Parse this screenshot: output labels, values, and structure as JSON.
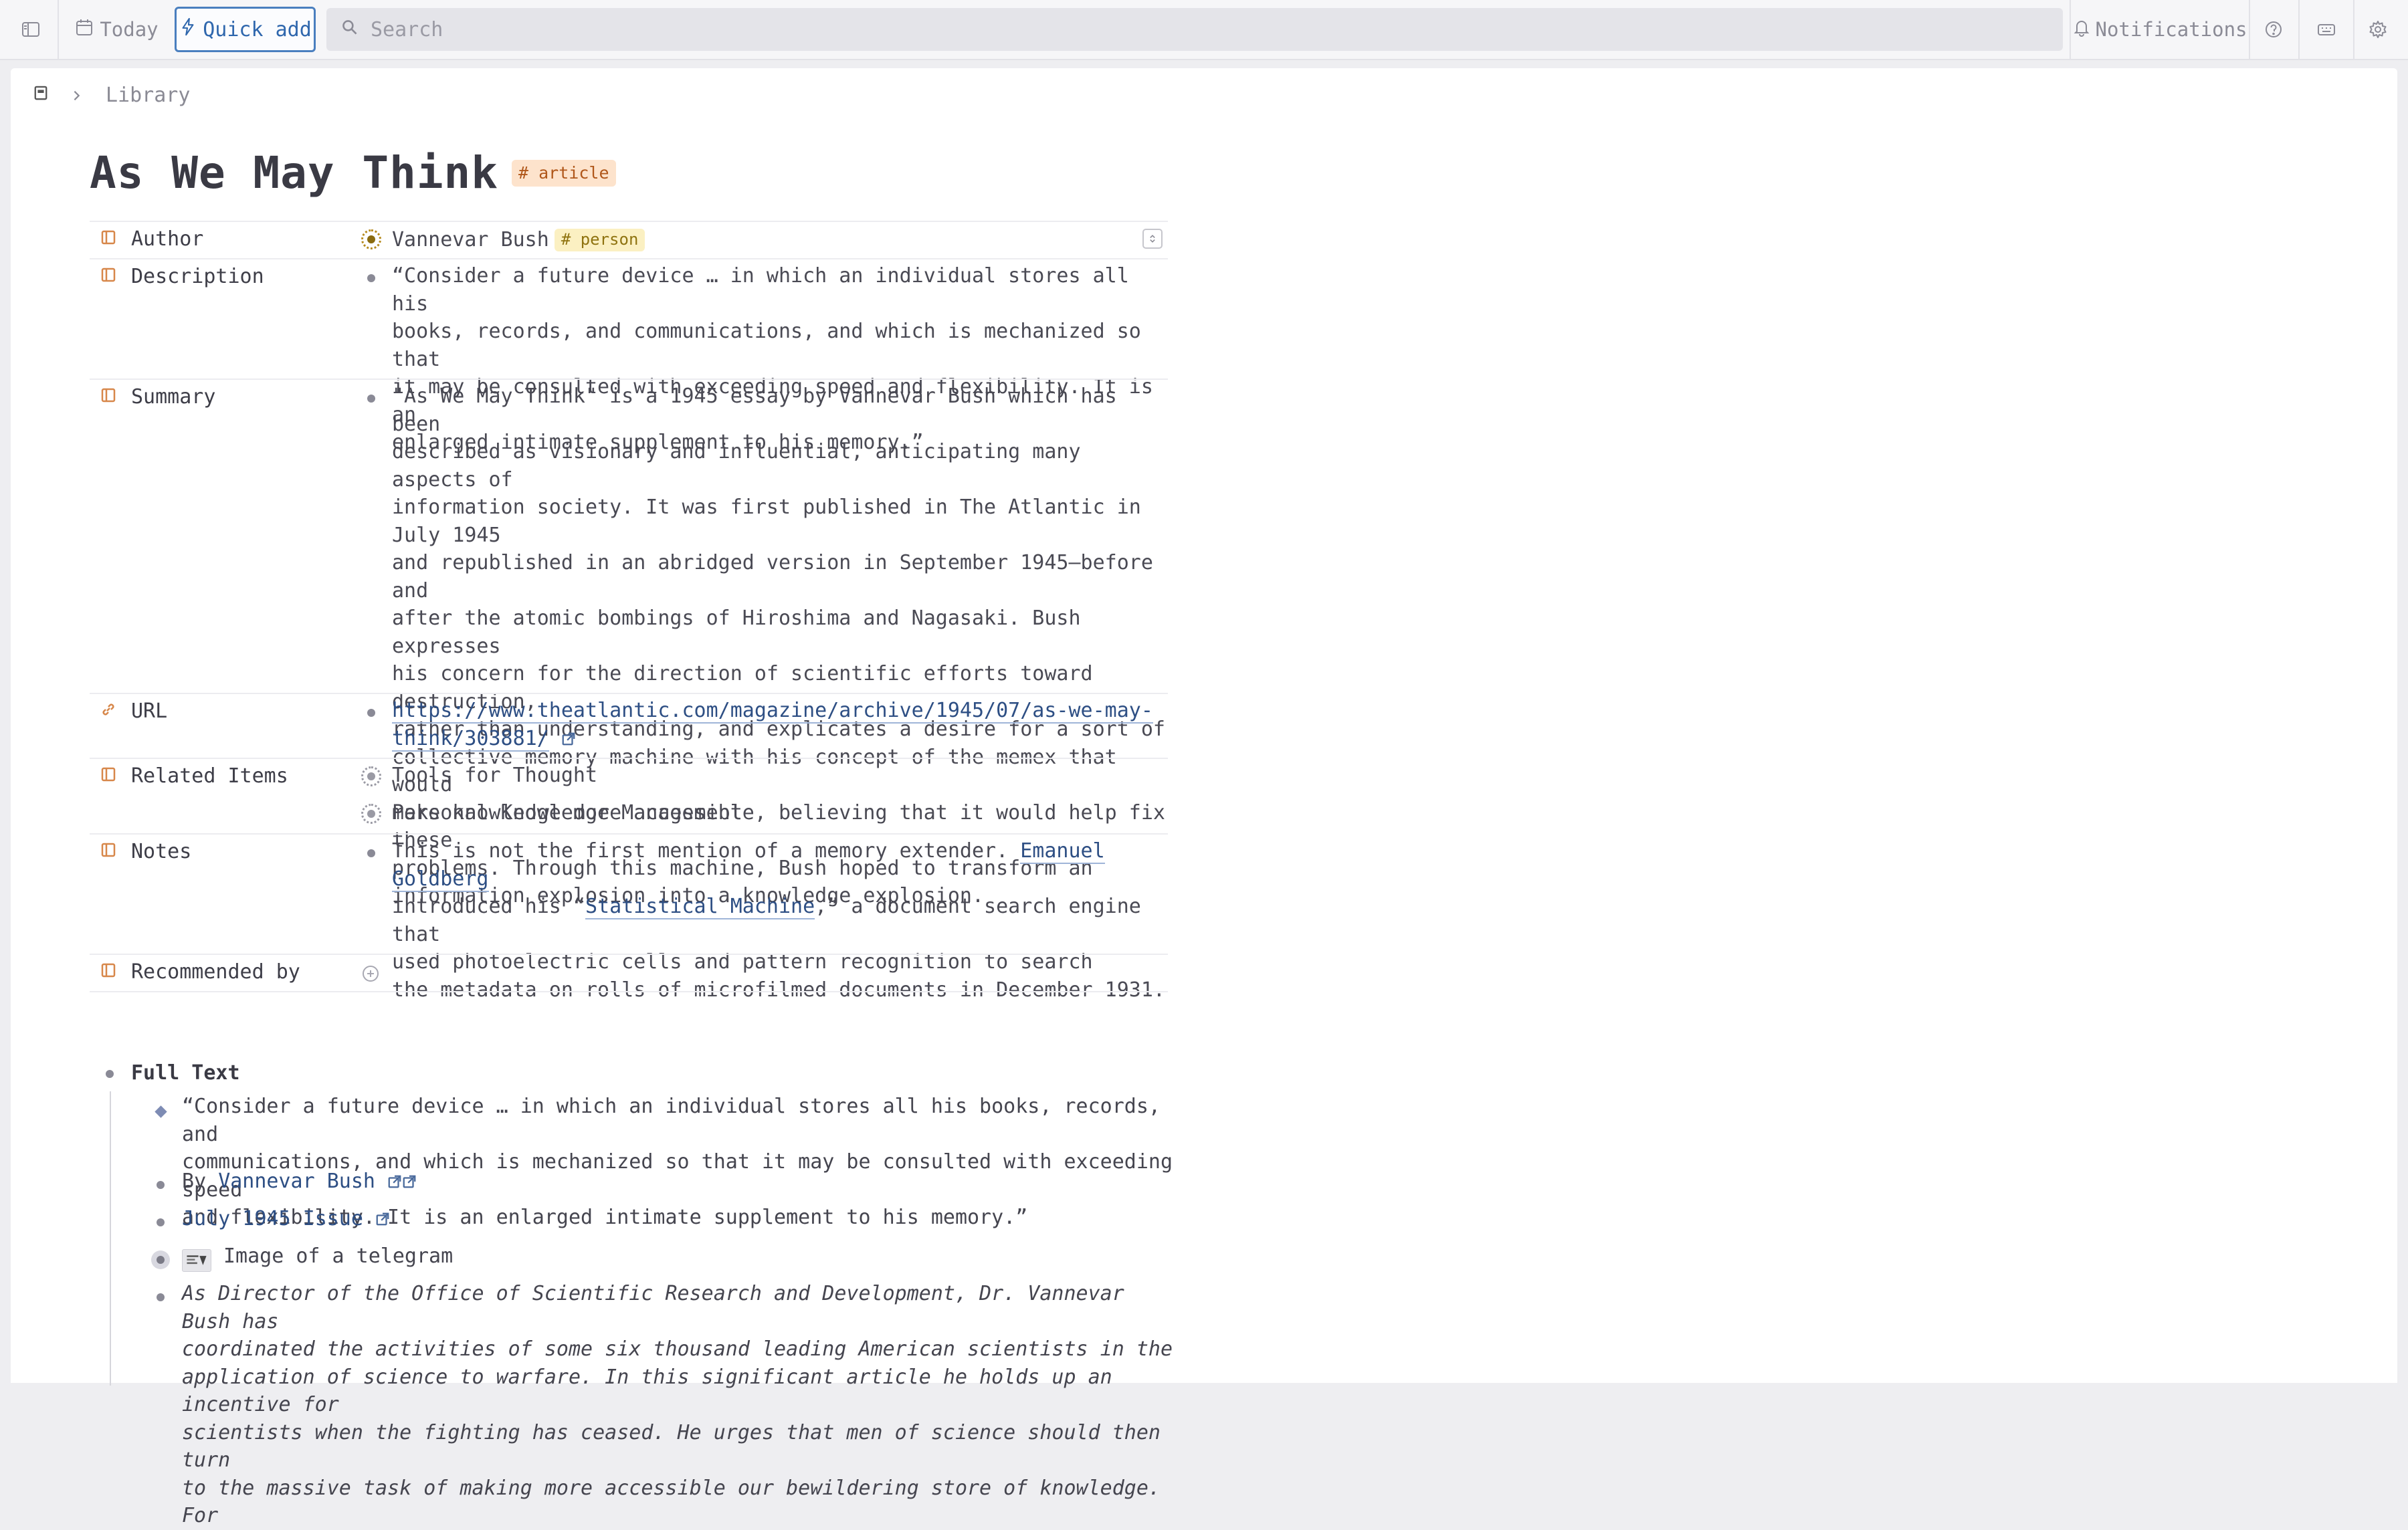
{
  "topbar": {
    "today_label": "Today",
    "quick_add_label": "Quick add",
    "search_placeholder": "Search",
    "notifications_label": "Notifications"
  },
  "breadcrumb": {
    "current": "Library"
  },
  "page": {
    "title": "As We May Think",
    "tag": "# article"
  },
  "fields": {
    "author": {
      "label": "Author",
      "value": "Vannevar Bush",
      "tag": "# person"
    },
    "description": {
      "label": "Description",
      "lines": [
        "“Consider a future device …  in which an individual stores all his",
        "books, records, and communications, and which is mechanized so that",
        "it may be consulted with exceeding speed and flexibility. It is an",
        "enlarged intimate supplement to his memory.”"
      ]
    },
    "summary": {
      "label": "Summary",
      "lines": [
        "\"As We May Think\" is a 1945 essay by Vannevar Bush which has been",
        "described as visionary and influential, anticipating many aspects of",
        "information society. It was first published in The Atlantic in July 1945",
        "and republished in an abridged version in September 1945—before and",
        "after the atomic bombings of Hiroshima and Nagasaki. Bush expresses",
        "his concern for the direction of scientific efforts toward destruction,",
        "rather than understanding, and explicates a desire for a sort of",
        "collective memory machine with his concept of the memex that would",
        "make knowledge more accessible, believing that it would help fix these",
        "problems. Through this machine, Bush hoped to transform an",
        "information explosion into a knowledge explosion."
      ]
    },
    "url": {
      "label": "URL",
      "line1": "https://www.theatlantic.com/magazine/archive/1945/07/as-we-may-",
      "line2": "think/303881/"
    },
    "related": {
      "label": "Related Items",
      "items": [
        "Tools for Thought",
        "Personal Knowledge Management"
      ]
    },
    "notes": {
      "label": "Notes",
      "l1_pre": "This is not the first mention of a memory extender. ",
      "l1_link": "Emanuel Goldberg",
      "l2_pre": "introduced his “",
      "l2_link": "Statistical Machine",
      "l2_post": ",” a document search engine that",
      "l3": "used photoelectric cells and pattern recognition to search",
      "l4": "the metadata on rolls of microfilmed documents in December 1931."
    },
    "recommended": {
      "label": "Recommended by"
    }
  },
  "full_text": {
    "label": "Full Text",
    "quote_lines": [
      "“Consider a future device … in which an individual stores all his books, records, and",
      "communications, and which is mechanized so that it may be consulted with exceeding speed",
      "and flexibility. It is an enlarged intimate supplement to his memory.”"
    ],
    "by_prefix": "By ",
    "by_link": "Vannevar Bush",
    "issue_link": "July 1945 Issue",
    "image_caption": "Image of a telegram",
    "intro_lines": [
      "As Director of the Office of Scientific Research and Development, Dr. Vannevar Bush has",
      "coordinated the activities of some six thousand leading American scientists in the",
      "application of science to warfare. In this significant article he holds up an incentive for",
      "scientists when the fighting has ceased. He urges that men of science should then turn",
      "to the massive task of making more accessible our bewildering store of knowledge. For"
    ]
  }
}
